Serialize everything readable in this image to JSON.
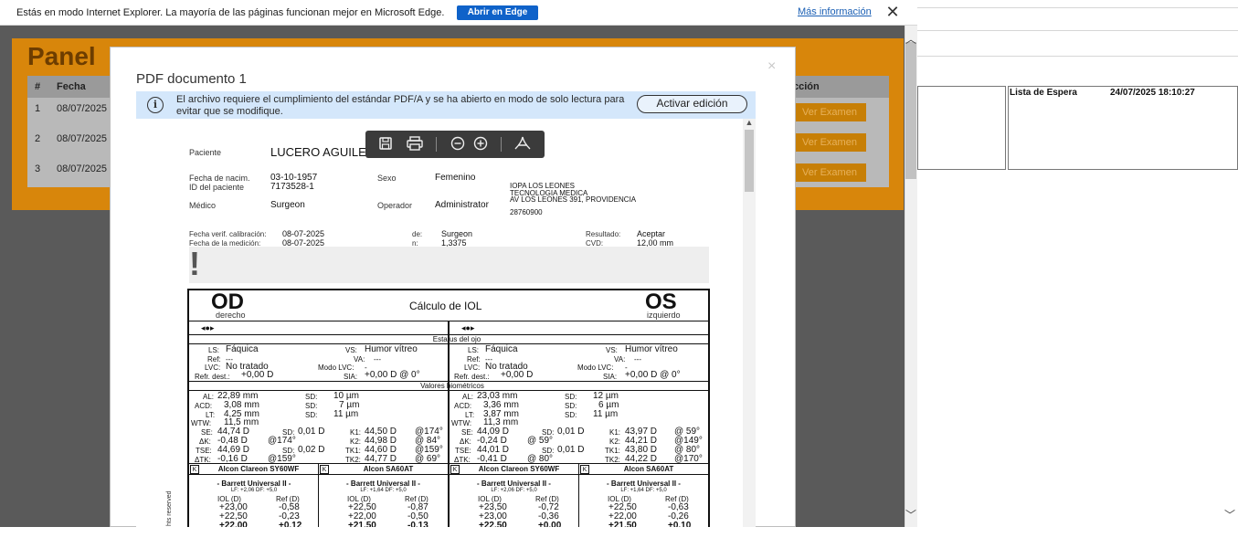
{
  "ie_banner": {
    "message": "Estás en modo Internet Explorer. La mayoría de las páginas funcionan mejor en Microsoft Edge.",
    "open_edge": "Abrir en Edge",
    "more_info": "Más información",
    "close": "✕"
  },
  "background_app": {
    "title": "Panel",
    "columns": [
      "#",
      "Fecha",
      "cción"
    ],
    "rows": [
      {
        "num": "1",
        "date": "08/07/2025",
        "action": "Ver Examen"
      },
      {
        "num": "2",
        "date": "08/07/2025",
        "action": "Ver Examen"
      },
      {
        "num": "3",
        "date": "08/07/2025",
        "action": "Ver Examen"
      }
    ]
  },
  "right_panel": {
    "lista_label": "Lista de Espera",
    "lista_timestamp": "24/07/2025 18:10:27"
  },
  "modal": {
    "title": "PDF documento 1",
    "close": "×",
    "pdfa_notice": "El archivo requiere el cumplimiento del estándar PDF/A y se ha abierto en modo de solo lectura para evitar que se modifique.",
    "edit_button": "Activar edición",
    "toolbar_icons": [
      "save-icon",
      "print-icon",
      "zoom-out-icon",
      "zoom-in-icon",
      "acrobat-icon"
    ]
  },
  "pdf": {
    "patient_label": "Paciente",
    "patient_name": "LUCERO AGUILERA",
    "dob_label": "Fecha de nacim.",
    "dob": "03-10-1957",
    "id_label": "ID del paciente",
    "id": "7173528-1",
    "sex_label": "Sexo",
    "sex": "Femenino",
    "doctor_label": "Médico",
    "doctor": "Surgeon",
    "operator_label": "Operador",
    "operator": "Administrator",
    "clinic_lines": [
      "IOPA LOS LEONES",
      "TECNOLOGIA MEDICA",
      "AV LOS LEONES 391, PROVIDENCIA"
    ],
    "clinic_phone": "28760900",
    "calib_label": "Fecha verif. calibración:",
    "calib_date": "08-07-2025",
    "meas_label": "Fecha de la medición:",
    "meas_date": "08-07-2025",
    "de_label": "de:",
    "de_value": "Surgeon",
    "n_label": "n:",
    "n_value": "1,3375",
    "result_label": "Resultado:",
    "result_value": "Aceptar",
    "cvd_label": "CVD:",
    "cvd_value": "12,00 mm",
    "alert": "!",
    "iol_title": "Cálculo de IOL",
    "od": "OD",
    "od_sub": "derecho",
    "os": "OS",
    "os_sub": "izquierdo",
    "eye_status_title": "Estatus del ojo",
    "biometric_title": "Valores biométricos",
    "rights": "hts reserved",
    "od_status": {
      "ls": "Fáquica",
      "vs": "Humor vítreo",
      "ref": "---",
      "va": "---",
      "lvc": "No tratado",
      "modo_lvc": "-",
      "refr": "+0,00 D",
      "sia": "+0,00 D @ 0°"
    },
    "os_status": {
      "ls": "Fáquica",
      "vs": "Humor vítreo",
      "ref": "---",
      "va": "---",
      "lvc": "No tratado",
      "modo_lvc": "-",
      "refr": "+0,00 D",
      "sia": "+0,00 D @ 0°"
    },
    "od_bio": {
      "al": "22,89 mm",
      "al_sd": "10 µm",
      "acd": "3,08 mm",
      "acd_sd": "7 µm",
      "lt": "4,25 mm",
      "lt_sd": "11 µm",
      "wtw": "11,5 mm",
      "se": "44,74 D",
      "se_sd": "0,01 D",
      "k1": "44,50 D",
      "k1_ax": "@174°",
      "dk": "-0,48 D",
      "dk_ax": "@174°",
      "k2": "44,98 D",
      "k2_ax": "@ 84°",
      "tse": "44,69 D",
      "tse_sd": "0,02 D",
      "tk1": "44,60 D",
      "tk1_ax": "@159°",
      "dtk": "-0,16 D",
      "dtk_ax": "@159°",
      "tk2": "44,77 D",
      "tk2_ax": "@ 69°"
    },
    "os_bio": {
      "al": "23,03 mm",
      "al_sd": "12 µm",
      "acd": "3,36 mm",
      "acd_sd": "6 µm",
      "lt": "3,87 mm",
      "lt_sd": "11 µm",
      "wtw": "11,3 mm",
      "se": "44,09 D",
      "se_sd": "0,01 D",
      "k1": "43,97 D",
      "k1_ax": "@  59°",
      "dk": "-0,24 D",
      "dk_ax": "@  59°",
      "k2": "44,21 D",
      "k2_ax": "@149°",
      "tse": "44,01 D",
      "tse_sd": "0,01 D",
      "tk1": "43,80 D",
      "tk1_ax": "@  80°",
      "dtk": "-0,41 D",
      "dtk_ax": "@  80°",
      "tk2": "44,22 D",
      "tk2_ax": "@170°"
    },
    "lenses": [
      {
        "name": "Alcon Clareon SY60WF",
        "formula": "- Barrett Universal II -",
        "params": "LF: +2,06  DF: +5,0",
        "rows": [
          [
            "+23,00",
            "-0,58"
          ],
          [
            "+22,50",
            "-0,23"
          ],
          [
            "+22,00",
            "+0,12"
          ]
        ]
      },
      {
        "name": "Alcon SA60AT",
        "formula": "- Barrett Universal II -",
        "params": "LF: +1,64  DF: +5,0",
        "rows": [
          [
            "+22,50",
            "-0,87"
          ],
          [
            "+22,00",
            "-0,50"
          ],
          [
            "+21,50",
            "-0,13"
          ]
        ]
      },
      {
        "name": "Alcon Clareon SY60WF",
        "formula": "- Barrett Universal II -",
        "params": "LF: +2,06  DF: +5,0",
        "rows": [
          [
            "+23,50",
            "-0,72"
          ],
          [
            "+23,00",
            "-0,36"
          ],
          [
            "+22,50",
            "+0,00"
          ]
        ]
      },
      {
        "name": "Alcon SA60AT",
        "formula": "- Barrett Universal II -",
        "params": "LF: +1,64  DF: +5,0",
        "rows": [
          [
            "+22,50",
            "-0,63"
          ],
          [
            "+22,00",
            "-0,26"
          ],
          [
            "+21,50",
            "+0,10"
          ]
        ]
      }
    ],
    "iol_col": "IOL (D)",
    "ref_col": "Ref (D)"
  }
}
